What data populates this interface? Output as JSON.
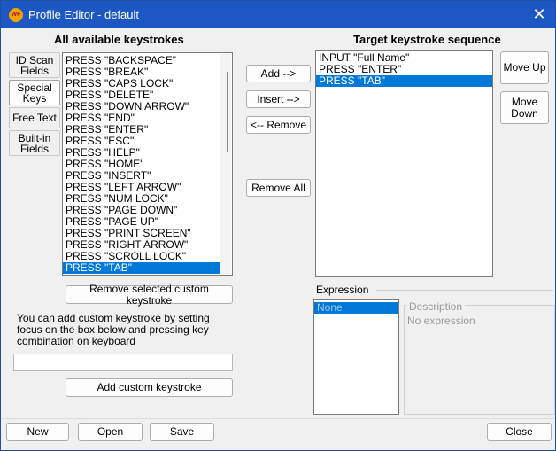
{
  "window": {
    "title": "Profile Editor - default",
    "app_icon_text": "WF"
  },
  "headings": {
    "available": "All available keystrokes",
    "target": "Target keystroke sequence",
    "expression": "Expression"
  },
  "tabs": [
    {
      "label": "ID Scan Fields",
      "selected": false
    },
    {
      "label": "Special Keys",
      "selected": true
    },
    {
      "label": "Free Text",
      "selected": false
    },
    {
      "label": "Built-in Fields",
      "selected": false
    }
  ],
  "available_keystrokes": [
    "PRESS \"BACKSPACE\"",
    "PRESS \"BREAK\"",
    "PRESS \"CAPS LOCK\"",
    "PRESS \"DELETE\"",
    "PRESS \"DOWN ARROW\"",
    "PRESS \"END\"",
    "PRESS \"ENTER\"",
    "PRESS \"ESC\"",
    "PRESS \"HELP\"",
    "PRESS \"HOME\"",
    "PRESS \"INSERT\"",
    "PRESS \"LEFT ARROW\"",
    "PRESS \"NUM LOCK\"",
    "PRESS \"PAGE DOWN\"",
    "PRESS \"PAGE UP\"",
    "PRESS \"PRINT SCREEN\"",
    "PRESS \"RIGHT ARROW\"",
    "PRESS \"SCROLL LOCK\"",
    "PRESS \"TAB\""
  ],
  "available_selected_index": 18,
  "target_sequence": [
    "INPUT \"Full Name\"",
    "PRESS \"ENTER\"",
    "PRESS \"TAB\""
  ],
  "target_selected_index": 2,
  "buttons": {
    "add": "Add -->",
    "insert": "Insert -->",
    "remove": "<-- Remove",
    "remove_all": "Remove All",
    "move_up": "Move Up",
    "move_down": "Move Down",
    "remove_custom": "Remove selected custom keystroke",
    "add_custom": "Add custom keystroke",
    "new": "New",
    "open": "Open",
    "save": "Save",
    "close": "Close"
  },
  "custom_hint": "You can add custom keystroke by setting focus on the box below and pressing key combination on keyboard",
  "custom_input_value": "",
  "expression": {
    "selected_item": "None",
    "description_label": "Description",
    "description_text": "No expression"
  },
  "colors": {
    "titlebar": "#1c57c4",
    "selection": "#0078d7"
  }
}
